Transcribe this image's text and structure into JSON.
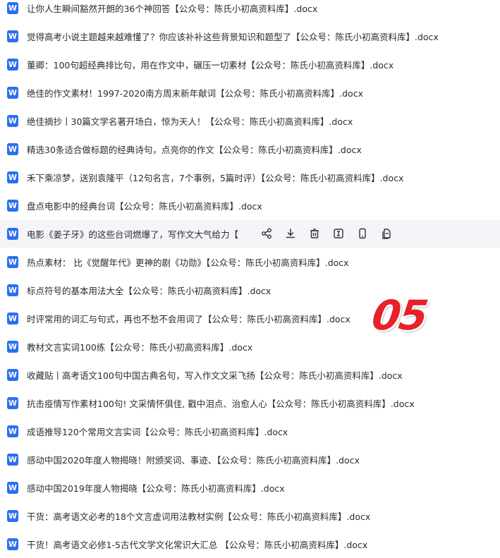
{
  "files": [
    {
      "icon": "word-file-icon",
      "icon_letter": "W",
      "name": "让你人生瞬间豁然开朗的36个神回答【公众号：陈氏小初高资料库】.docx"
    },
    {
      "icon": "word-file-icon",
      "icon_letter": "W",
      "name": "觉得高考小说主题越来越难懂了？你应该补补这些背景知识和题型了【公众号：陈氏小初高资料库】.docx"
    },
    {
      "icon": "word-file-icon",
      "icon_letter": "W",
      "name": "董卿：100句超经典排比句，用在作文中，碾压一切素材【公众号：陈氏小初高资料库】.docx"
    },
    {
      "icon": "word-file-icon",
      "icon_letter": "W",
      "name": "绝佳的作文素材！1997-2020南方周末新年献词【公众号：陈氏小初高资料库】.docx"
    },
    {
      "icon": "word-file-icon",
      "icon_letter": "W",
      "name": "绝佳摘抄丨30篇文学名著开场白，惊为天人！【公众号：陈氏小初高资料库】.docx"
    },
    {
      "icon": "word-file-icon",
      "icon_letter": "W",
      "name": "精选30条适合做标题的经典诗句，点亮你的作文【公众号：陈氏小初高资料库】.docx"
    },
    {
      "icon": "word-file-icon",
      "icon_letter": "W",
      "name": "禾下乘凉梦，送别袁隆平（12句名言，7个事例，5篇时评）【公众号：陈氏小初高资料库】.docx"
    },
    {
      "icon": "word-file-icon",
      "icon_letter": "W",
      "name": "盘点电影中的经典台词【公众号：陈氏小初高资料库】.docx"
    },
    {
      "icon": "word-file-icon",
      "icon_letter": "W",
      "name": "电影《姜子牙》的这些台词燃爆了，写作文大气给力【公..."
    },
    {
      "icon": "word-file-icon",
      "icon_letter": "W",
      "name": "热点素材： 比《觉醒年代》更神的剧《功勋》【公众号：陈氏小初高资料库】.docx"
    },
    {
      "icon": "word-file-icon",
      "icon_letter": "W",
      "name": "标点符号的基本用法大全【公众号：陈氏小初高资料库】.docx"
    },
    {
      "icon": "word-file-icon",
      "icon_letter": "W",
      "name": "时评常用的词汇与句式，再也不愁不会用词了【公众号：陈氏小初高资料库】.docx"
    },
    {
      "icon": "word-file-icon",
      "icon_letter": "W",
      "name": "教材文言实词100练【公众号：陈氏小初高资料库】.docx"
    },
    {
      "icon": "word-file-icon",
      "icon_letter": "W",
      "name": "收藏贴丨高考语文100句中国古典名句，写入作文文采飞扬【公众号：陈氏小初高资料库】.docx"
    },
    {
      "icon": "word-file-icon",
      "icon_letter": "W",
      "name": "抗击疫情写作素材100句! 文采情怀俱佳, 戳中泪点、治愈人心【公众号：陈氏小初高资料库】.docx"
    },
    {
      "icon": "word-file-icon",
      "icon_letter": "W",
      "name": "成语推导120个常用文言实词【公众号：陈氏小初高资料库】.docx"
    },
    {
      "icon": "word-file-icon",
      "icon_letter": "W",
      "name": "感动中国2020年度人物揭晓！附颁奖词、事迹、【公众号：陈氏小初高资料库】.docx"
    },
    {
      "icon": "word-file-icon",
      "icon_letter": "W",
      "name": "感动中国2019年度人物揭晓【公众号：陈氏小初高资料库】.docx"
    },
    {
      "icon": "word-file-icon",
      "icon_letter": "W",
      "name": "干货：高考语文必考的18个文言虚词用法教材实例【公众号：陈氏小初高资料库】.docx"
    },
    {
      "icon": "word-file-icon",
      "icon_letter": "W",
      "name": "干货！高考语文必修1-5古代文学文化常识大汇总 【公众号：陈氏小初高资料库】.docx"
    }
  ],
  "hover_actions": [
    {
      "icon": "share-icon"
    },
    {
      "icon": "download-icon"
    },
    {
      "icon": "delete-icon"
    },
    {
      "icon": "rename-icon"
    },
    {
      "icon": "mobile-icon"
    },
    {
      "icon": "copy-icon"
    }
  ],
  "badge": {
    "text": "05",
    "color": "#e8202a"
  },
  "colors": {
    "word_blue": "#2b6ff0",
    "hover_bg": "#f4f5f8"
  }
}
